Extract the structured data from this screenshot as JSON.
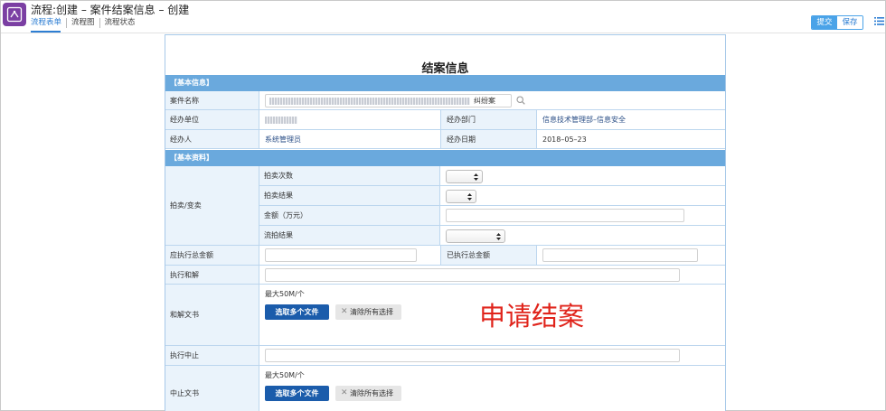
{
  "header": {
    "title": "流程:创建 – 案件结案信息 – 创建",
    "tabs": [
      {
        "label": "流程表单",
        "active": true
      },
      {
        "label": "流程图",
        "active": false
      },
      {
        "label": "流程状态",
        "active": false
      }
    ],
    "submit_label": "提交",
    "save_label": "保存",
    "app_icon": "flow-icon",
    "menu_icon": "list-icon"
  },
  "form": {
    "title": "结案信息",
    "basic_info_header": "【基本信息】",
    "case_name_label": "案件名称",
    "case_name_value_visible": "纠纷案",
    "unit_label": "经办单位",
    "dept_label": "经办部门",
    "dept_value": "信息技术管理部–信息安全",
    "handler_label": "经办人",
    "handler_value": "系统管理员",
    "date_label": "经办日期",
    "date_value": "2018–05–23",
    "basic_data_header": "【基本资料】",
    "auction_label": "拍卖/变卖",
    "auction_rows": [
      {
        "label": "拍卖次数"
      },
      {
        "label": "拍卖结果"
      },
      {
        "label": "金额（万元）"
      },
      {
        "label": "流拍结果"
      }
    ],
    "total_due_label": "应执行总金额",
    "total_done_label": "已执行总金额",
    "settlement_label": "执行和解",
    "settlement_doc_label": "和解文书",
    "max_size": "最大50M/个",
    "choose_files": "选取多个文件",
    "clear_selection": "清除所有选择",
    "suspend_label": "执行中止",
    "suspend_doc_label": "中止文书"
  },
  "overlay": "申请结案",
  "colors": {
    "section_header": "#6aa9dd",
    "label_bg": "#eaf3fb",
    "primary_button": "#1b5cab",
    "tab_active": "#2d7ed3",
    "overlay_text": "#e0241b",
    "app_icon_bg": "#7b3fa3"
  }
}
